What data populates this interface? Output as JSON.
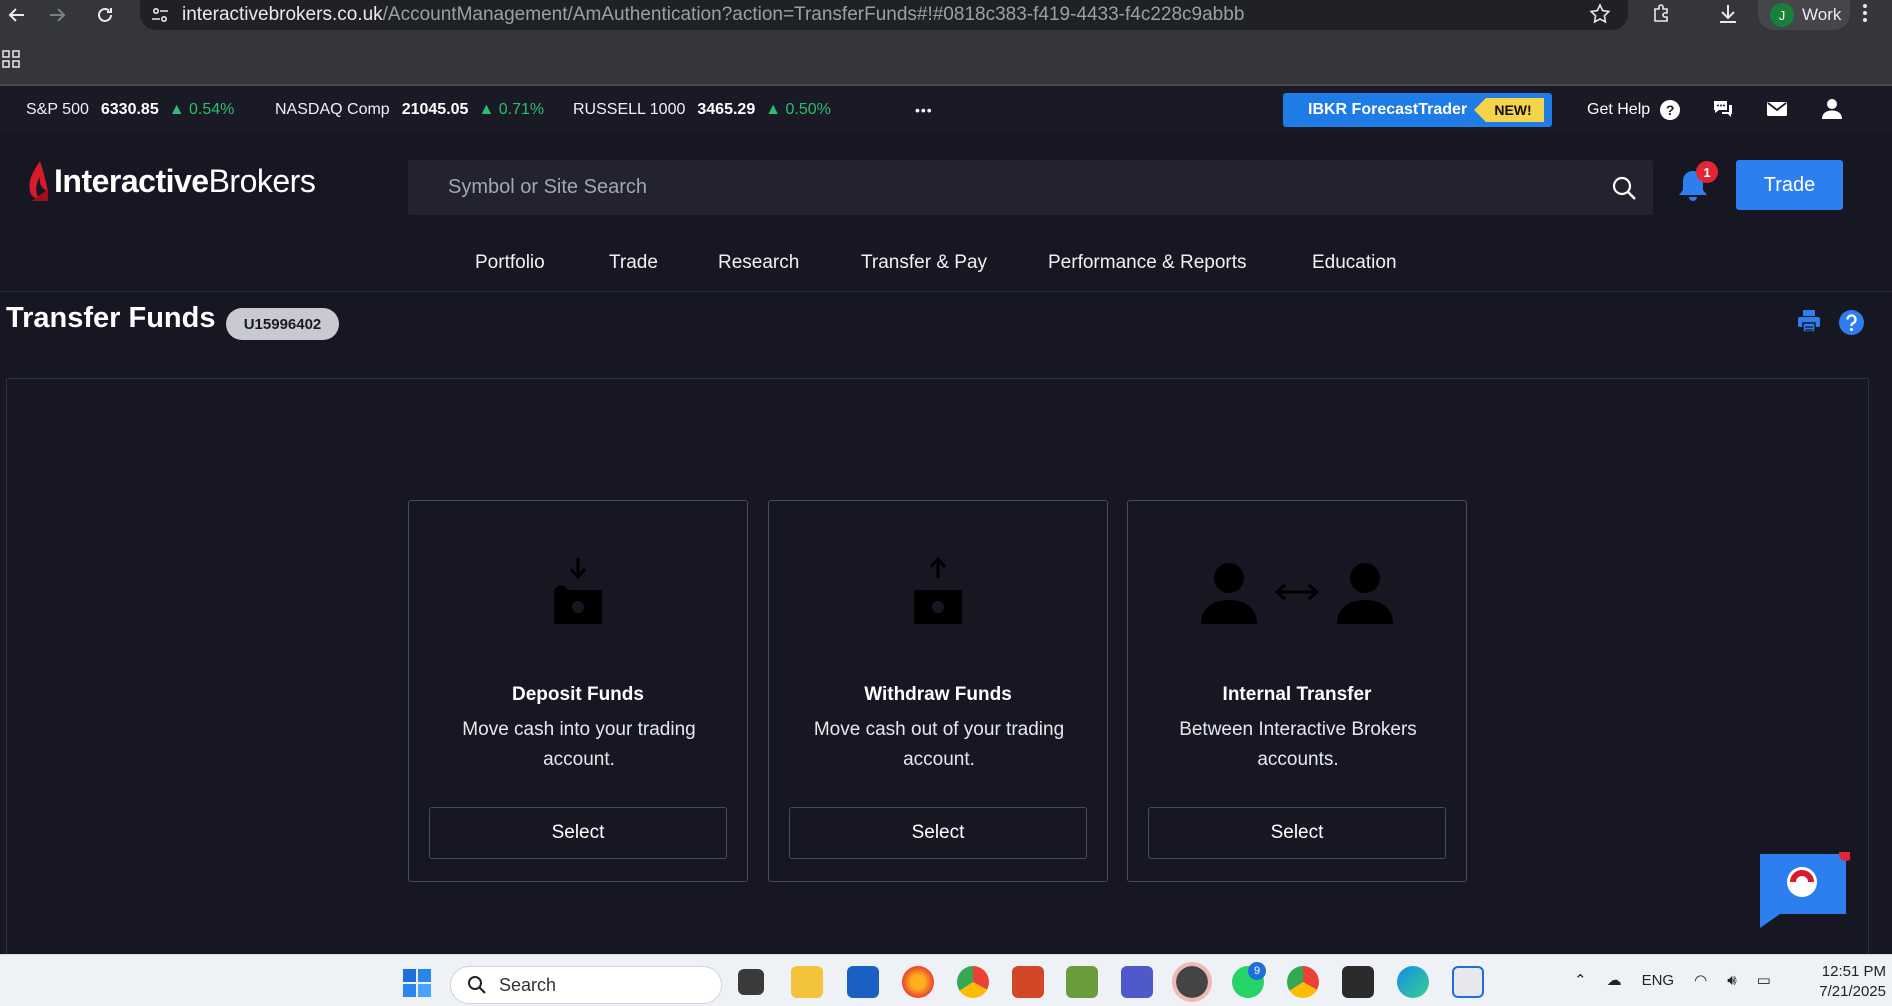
{
  "browser": {
    "url_domain": "interactivebrokers.co.uk",
    "url_path": "/AccountManagement/AmAuthentication?action=TransferFunds#!#0818c383-f419-4433-f4c228c9abbb",
    "profile_initial": "J",
    "profile_label": "Work"
  },
  "ticker": {
    "items": [
      {
        "name": "S&P 500",
        "value": "6330.85",
        "change": "▲ 0.54%"
      },
      {
        "name": "NASDAQ Comp",
        "value": "21045.05",
        "change": "▲ 0.71%"
      },
      {
        "name": "RUSSELL 1000",
        "value": "3465.29",
        "change": "▲ 0.50%"
      }
    ],
    "more_label": "•••",
    "forecast_label": "IBKR ForecastTrader",
    "new_label": "NEW!",
    "get_help_label": "Get Help",
    "help_glyph": "?"
  },
  "header": {
    "logo_part1": "Interactive",
    "logo_part2": "Brokers",
    "search_placeholder": "Symbol or Site Search",
    "notification_count": "1",
    "trade_label": "Trade"
  },
  "nav": {
    "items": [
      "Portfolio",
      "Trade",
      "Research",
      "Transfer & Pay",
      "Performance & Reports",
      "Education"
    ]
  },
  "page": {
    "title": "Transfer Funds",
    "account_id": "U15996402"
  },
  "cards": [
    {
      "title": "Deposit Funds",
      "desc": "Move cash into your trading account.",
      "button": "Select",
      "icon": "deposit-icon"
    },
    {
      "title": "Withdraw Funds",
      "desc": "Move cash out of your trading account.",
      "button": "Select",
      "icon": "withdraw-icon"
    },
    {
      "title": "Internal Transfer",
      "desc": "Between Interactive Brokers accounts.",
      "button": "Select",
      "icon": "internal-transfer-icon"
    }
  ],
  "taskbar": {
    "search_label": "Search",
    "language": "ENG",
    "time": "12:51 PM",
    "date": "7/21/2025",
    "whatsapp_badge": "9"
  },
  "colors": {
    "accent_blue": "#2d7ff0",
    "positive_green": "#2ebd6b",
    "background": "#161722",
    "badge_red": "#e32636",
    "new_yellow": "#f5d34a"
  }
}
